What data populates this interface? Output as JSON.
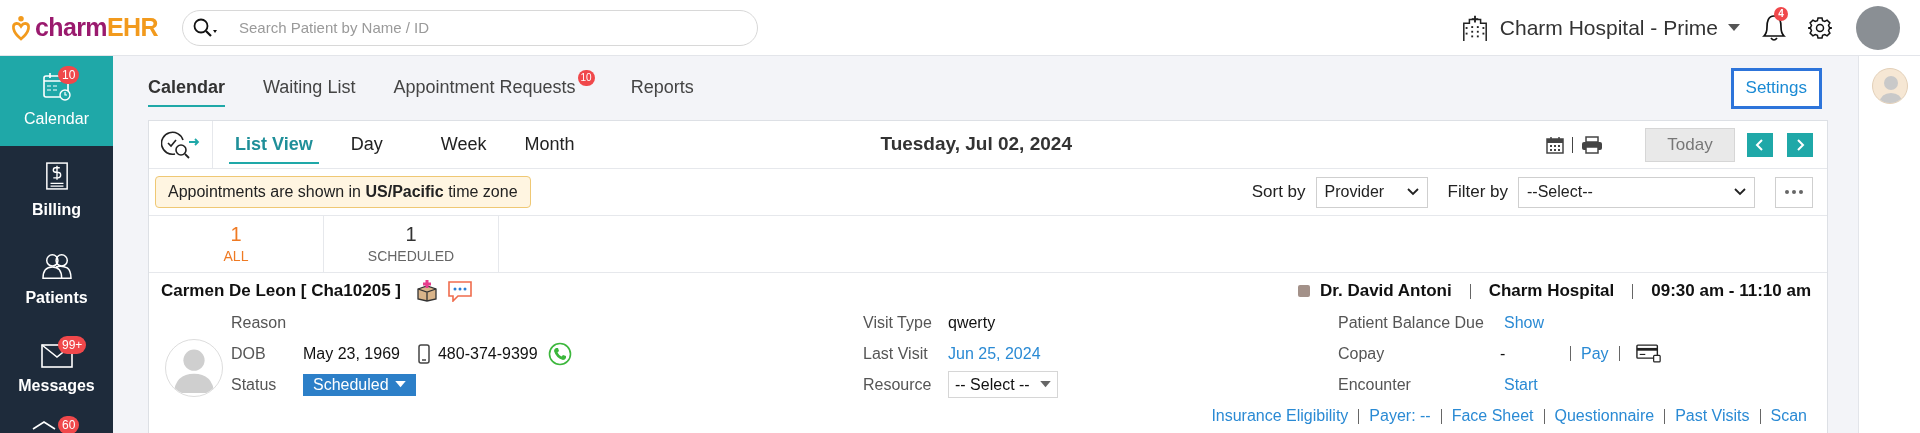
{
  "logo": {
    "part_1": "charm",
    "part_2": "EHR"
  },
  "header": {
    "search": {
      "placeholder": "Search Patient by Name / ID"
    },
    "location": "Charm Hospital - Prime",
    "notification_count": "4"
  },
  "sidebar": {
    "items": [
      {
        "label": "Calendar",
        "badge": "10",
        "selected": true
      },
      {
        "label": "Billing",
        "selected": false
      },
      {
        "label": "Patients",
        "selected": false
      },
      {
        "label": "Messages",
        "badge": "99+",
        "selected": false
      },
      {
        "badge": "60",
        "selected": false
      }
    ]
  },
  "tabs": [
    {
      "label": "Calendar",
      "selected": true
    },
    {
      "label": "Waiting List",
      "selected": false
    },
    {
      "label": "Appointment Requests",
      "badge": "10",
      "selected": false
    },
    {
      "label": "Reports",
      "selected": false
    }
  ],
  "settings_button": "Settings",
  "view_tabs": [
    {
      "label": "List View",
      "selected": true
    },
    {
      "label": "Day",
      "selected": false
    },
    {
      "label": "Week",
      "selected": false
    },
    {
      "label": "Month",
      "selected": false
    }
  ],
  "date": "Tuesday, Jul 02, 2024",
  "today_button": "Today",
  "timezone_notice": "Appointments are shown in **US/Pacific** time zone",
  "sort_by": {
    "label": "Sort by",
    "value": "Provider"
  },
  "filter_by": {
    "label": "Filter by",
    "value": "--Select--"
  },
  "counts": [
    {
      "count": "1",
      "label": "ALL",
      "selected": true
    },
    {
      "count": "1",
      "label": "SCHEDULED",
      "selected": false
    }
  ],
  "appointment": {
    "patient": "Carmen De Leon [ Cha10205 ]",
    "provider": {
      "name": "Dr. David Antoni",
      "color": "#a39189"
    },
    "facility": "Charm Hospital",
    "time": "09:30 am - 11:10 am",
    "reason_label": "Reason",
    "dob_label": "DOB",
    "dob": "May 23, 1969",
    "phone": "480-374-9399",
    "status_label": "Status",
    "status": "Scheduled",
    "visit_type_label": "Visit Type",
    "visit_type": "qwerty",
    "last_visit_label": "Last Visit",
    "last_visit": "Jun 25, 2024",
    "resource_label": "Resource",
    "resource": "-- Select --",
    "balance_label": "Patient Balance Due",
    "balance_link": "Show",
    "copay_label": "Copay",
    "copay": "-",
    "pay_link": "Pay",
    "encounter_label": "Encounter",
    "encounter_link": "Start",
    "links": [
      "Insurance Eligibility",
      "Payer: --",
      "Face Sheet",
      "Questionnaire",
      "Past Visits",
      "Scan"
    ]
  }
}
